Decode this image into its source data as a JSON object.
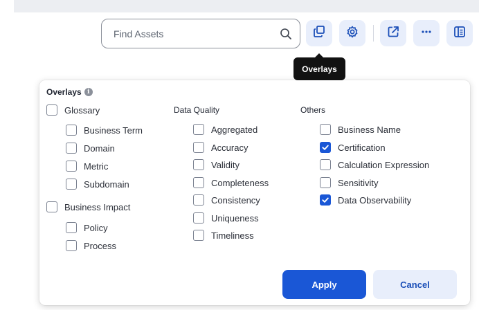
{
  "search": {
    "placeholder": "Find Assets"
  },
  "toolbar": {
    "buttons": [
      "overlays-icon",
      "gear-icon",
      "open-external-icon",
      "more-icon",
      "panel-icon"
    ],
    "tooltip": "Overlays"
  },
  "panel": {
    "title": "Overlays",
    "glossary": {
      "label": "Glossary",
      "checked": false,
      "items": [
        {
          "label": "Business Term",
          "checked": false
        },
        {
          "label": "Domain",
          "checked": false
        },
        {
          "label": "Metric",
          "checked": false
        },
        {
          "label": "Subdomain",
          "checked": false
        }
      ]
    },
    "business_impact": {
      "label": "Business Impact",
      "checked": false,
      "items": [
        {
          "label": "Policy",
          "checked": false
        },
        {
          "label": "Process",
          "checked": false
        }
      ]
    },
    "data_quality": {
      "header": "Data Quality",
      "items": [
        {
          "label": "Aggregated",
          "checked": false
        },
        {
          "label": "Accuracy",
          "checked": false
        },
        {
          "label": "Validity",
          "checked": false
        },
        {
          "label": "Completeness",
          "checked": false
        },
        {
          "label": "Consistency",
          "checked": false
        },
        {
          "label": "Uniqueness",
          "checked": false
        },
        {
          "label": "Timeliness",
          "checked": false
        }
      ]
    },
    "others": {
      "header": "Others",
      "items": [
        {
          "label": "Business Name",
          "checked": false
        },
        {
          "label": "Certification",
          "checked": true
        },
        {
          "label": "Calculation Expression",
          "checked": false
        },
        {
          "label": "Sensitivity",
          "checked": false
        },
        {
          "label": "Data Observability",
          "checked": true
        }
      ]
    },
    "apply_label": "Apply",
    "cancel_label": "Cancel"
  },
  "colors": {
    "primary": "#1a57d6",
    "light_button": "#e8eefb",
    "tooltip_bg": "#121212"
  }
}
